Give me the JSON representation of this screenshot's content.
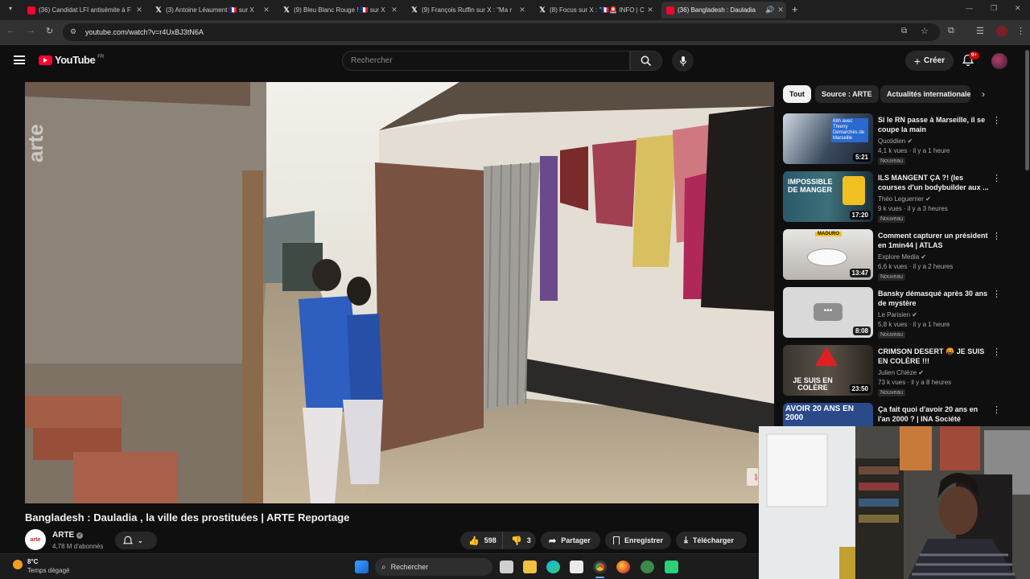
{
  "browser": {
    "tabs": [
      {
        "title": "(36) Candidat LFI antisémite à F",
        "icon": "youtube-icon"
      },
      {
        "title": "(3) Antoine Léaument 🇫🇷 sur X",
        "icon": "x-icon"
      },
      {
        "title": "(9) Bleu Blanc Rouge ! 🇫🇷 sur X",
        "icon": "x-icon"
      },
      {
        "title": "(9) François Ruffin sur X : \"Ma r",
        "icon": "x-icon"
      },
      {
        "title": "(8) Focus sur X : \"🇫🇷🚨 INFO | C",
        "icon": "x-icon"
      },
      {
        "title": "(36) Bangladesh : Dauladia",
        "icon": "youtube-icon",
        "active": true
      }
    ],
    "url": "youtube.com/watch?v=r4UxBJ3tN6A"
  },
  "youtube": {
    "logo": "YouTube",
    "region": "FR",
    "search_placeholder": "Rechercher",
    "create_label": "Créer",
    "notif_badge": "9+"
  },
  "video": {
    "watermark": "arte",
    "title": "Bangladesh : Dauladia , la ville des prostituées | ARTE Reportage",
    "channel": "ARTE",
    "channel_avatar": "arte",
    "subscribers": "4,78 M d'abonnés",
    "likes": "598",
    "dislikes": "3",
    "share_label": "Partager",
    "save_label": "Enregistrer",
    "download_label": "Télécharger"
  },
  "sidebar": {
    "chips": [
      "Tout",
      "Source : ARTE",
      "Actualités internationales"
    ],
    "recommendations": [
      {
        "title": "Si le RN passe à Marseille, il se coupe la main",
        "channel": "Quotidien",
        "meta": "4,1 k vues · il y a 1 heure",
        "badge": "Nouveau",
        "duration": "5:21",
        "thumb_text": "68h avec Thierry Démarches de Marseille"
      },
      {
        "title": "ILS MANGENT ÇA ?! (les courses d'un bodybuilder aux ...",
        "channel": "Théo Leguerrier",
        "meta": "9 k vues · il y a 3 heures",
        "badge": "Nouveau",
        "duration": "17:20",
        "thumb_text": "IMPOSSIBLE DE MANGER"
      },
      {
        "title": "Comment capturer un président en 1min44 | ATLAS",
        "channel": "Explore Media",
        "meta": "6,6 k vues · il y a 2 heures",
        "badge": "Nouveau",
        "duration": "13:47",
        "thumb_text": "MADURO"
      },
      {
        "title": "Bansky démasqué après 30 ans de mystère",
        "channel": "Le Parisien",
        "meta": "5,8 k vues · il y a 1 heure",
        "badge": "Nouveau",
        "duration": "8:08",
        "thumb_text": ""
      },
      {
        "title": "CRIMSON DESERT 🤬 JE SUIS EN COLÈRE !!!",
        "channel": "Julien Chièze",
        "meta": "73 k vues · il y a 8 heures",
        "badge": "Nouveau",
        "duration": "23:50",
        "thumb_text": "JE SUIS EN COLÈRE"
      },
      {
        "title": "Ça fait quoi d'avoir 20 ans en l'an 2000 ? | INA Société",
        "channel": "",
        "meta": "",
        "badge": "",
        "duration": "",
        "thumb_text": "AVOIR 20 ANS EN 2000"
      }
    ]
  },
  "taskbar": {
    "weather_temp": "8°C",
    "weather_desc": "Temps dégagé",
    "search_label": "Rechercher"
  }
}
